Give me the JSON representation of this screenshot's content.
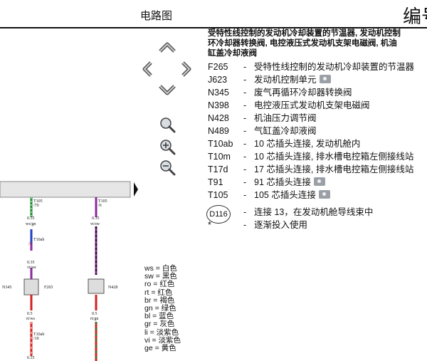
{
  "header": {
    "title": "电路图",
    "code_label": "编号"
  },
  "nav": {
    "pan_up": "pan-up",
    "pan_left": "pan-left",
    "pan_right": "pan-right",
    "pan_down": "pan-down",
    "zoom_fit": "zoom-fit",
    "zoom_in": "zoom-in",
    "zoom_out": "zoom-out"
  },
  "legend": {
    "heading": "受特性线控制的发动机冷却装置的节温器, 发动机控制\n环冷却器转换阀, 电控液压式发动机支架电磁阀, 机油\n缸盖冷却液阀",
    "items": [
      {
        "code": "F265",
        "desc": "受特性线控制的发动机冷却装置的节温器",
        "photo": false
      },
      {
        "code": "J623",
        "desc": "发动机控制单元",
        "photo": true
      },
      {
        "code": "N345",
        "desc": "废气再循环冷却器转换阀",
        "photo": false
      },
      {
        "code": "N398",
        "desc": "电控液压式发动机支架电磁阀",
        "photo": false
      },
      {
        "code": "N428",
        "desc": "机油压力调节阀",
        "photo": false
      },
      {
        "code": "N489",
        "desc": "气缸盖冷却液阀",
        "photo": false
      },
      {
        "code": "T10ab",
        "desc": "10 芯插头连接, 发动机舱内",
        "photo": false
      },
      {
        "code": "T10m",
        "desc": "10 芯插头连接, 排水槽电控箱左侧接线站",
        "photo": false
      },
      {
        "code": "T17d",
        "desc": "17 芯插头连接, 排水槽电控箱左侧接线站",
        "photo": false
      },
      {
        "code": "T91",
        "desc": "91 芯插头连接",
        "photo": true
      },
      {
        "code": "T105",
        "desc": "105 芯插头连接",
        "photo": true
      },
      {
        "code": "D116",
        "desc": "连接 13，在发动机舱导线束中",
        "photo": false
      },
      {
        "code": "*",
        "desc": "逐渐投入使用",
        "photo": false
      }
    ]
  },
  "colors": [
    {
      "abbr": "ws",
      "name": "白色"
    },
    {
      "abbr": "sw",
      "name": "黑色"
    },
    {
      "abbr": "ro",
      "name": "红色"
    },
    {
      "abbr": "rt",
      "name": "红色"
    },
    {
      "abbr": "br",
      "name": "褐色"
    },
    {
      "abbr": "gn",
      "name": "绿色"
    },
    {
      "abbr": "bl",
      "name": "蓝色"
    },
    {
      "abbr": "gr",
      "name": "灰色"
    },
    {
      "abbr": "li",
      "name": "淡紫色"
    },
    {
      "abbr": "vi",
      "name": "淡紫色"
    },
    {
      "abbr": "ge",
      "name": "黄色"
    }
  ],
  "diagram": {
    "w1_top_connector": "T105",
    "w1_top_pin": "/70",
    "w1_gauge1": "0.35",
    "w1_color1": "ws/gn",
    "w1_mid_connector": "T10ab",
    "w1_mid_pin": "/1",
    "w1_gauge2": "0.35",
    "w1_color2": "vi/sw",
    "w1_component": "N345",
    "w1_component2": "F265",
    "w1_gauge3": "0.5",
    "w1_color3": "rt/ws",
    "w1_bottom_connector": "T10ab",
    "w1_bottom_pin": "/10",
    "w1_gauge4": "0.35",
    "w2_top_connector": "T105",
    "w2_top_pin": "/6",
    "w2_gauge1": "0.35",
    "w2_color1": "vi/sw",
    "w2_component": "N428",
    "w2_gauge2": "0.5",
    "w2_color2": "rt/gn",
    "colors": {
      "green": "#1a8a2a",
      "white": "#ffffff",
      "violet": "#8a2a9a",
      "black": "#111111",
      "red": "#d62020",
      "blue": "#1f3fc8"
    }
  }
}
